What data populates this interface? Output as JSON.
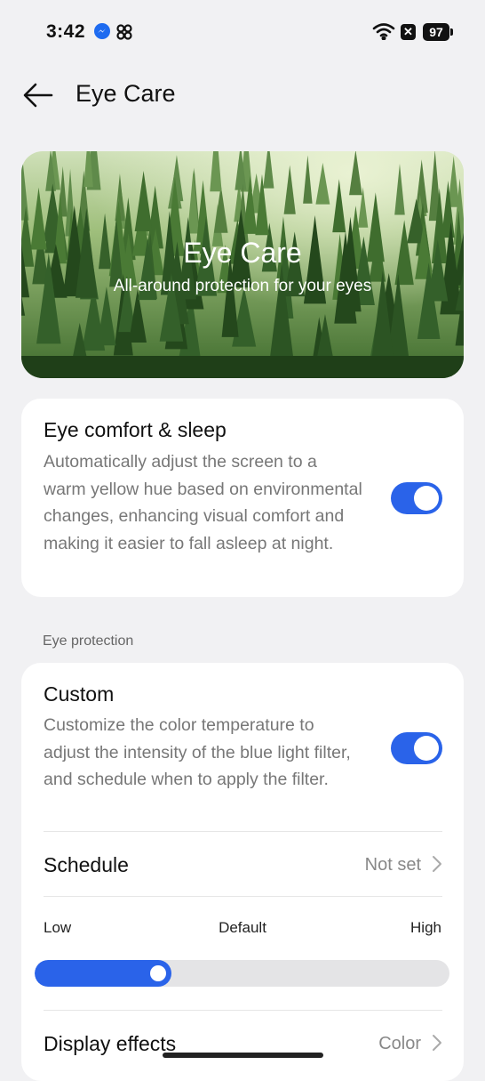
{
  "status_bar": {
    "time": "3:42",
    "battery": "97",
    "icons": [
      "messenger-icon",
      "pinwheel-icon",
      "wifi-icon",
      "x-app-icon",
      "battery-icon"
    ]
  },
  "header": {
    "title": "Eye Care",
    "back_icon": "arrow-left-icon"
  },
  "hero": {
    "title": "Eye Care",
    "subtitle": "All-around protection for your eyes"
  },
  "eye_comfort": {
    "title": "Eye comfort & sleep",
    "description": "Automatically adjust the screen to a warm yellow hue based on environmental changes, enhancing visual comfort and making it easier to fall asleep at night.",
    "enabled": true
  },
  "eye_protection": {
    "section_label": "Eye protection",
    "custom": {
      "title": "Custom",
      "description": "Customize the color temperature to adjust the intensity of the blue light filter, and schedule when to apply the filter.",
      "enabled": true
    },
    "schedule": {
      "label": "Schedule",
      "value": "Not set"
    },
    "intensity": {
      "low_label": "Low",
      "default_label": "Default",
      "high_label": "High",
      "level": 0.33
    },
    "display_effects": {
      "label": "Display effects",
      "value": "Color"
    }
  },
  "colors": {
    "accent": "#2a63e9",
    "background": "#f1f1f3",
    "card": "#ffffff"
  }
}
